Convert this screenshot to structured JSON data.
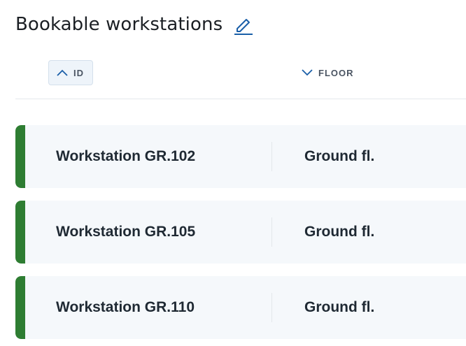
{
  "header": {
    "title": "Bookable workstations",
    "edit_icon": "pencil-icon",
    "accent_color": "#1a5fa8"
  },
  "columns": {
    "id": {
      "label": "ID",
      "sort": "ascending",
      "icon": "chevron-up-icon"
    },
    "floor": {
      "label": "FLOOR",
      "sort": "descending",
      "icon": "chevron-down-icon"
    }
  },
  "rows": [
    {
      "id": "Workstation GR.102",
      "floor": "Ground fl.",
      "status_color": "#2e7d32"
    },
    {
      "id": "Workstation GR.105",
      "floor": "Ground fl.",
      "status_color": "#2e7d32"
    },
    {
      "id": "Workstation GR.110",
      "floor": "Ground fl.",
      "status_color": "#2e7d32"
    }
  ]
}
